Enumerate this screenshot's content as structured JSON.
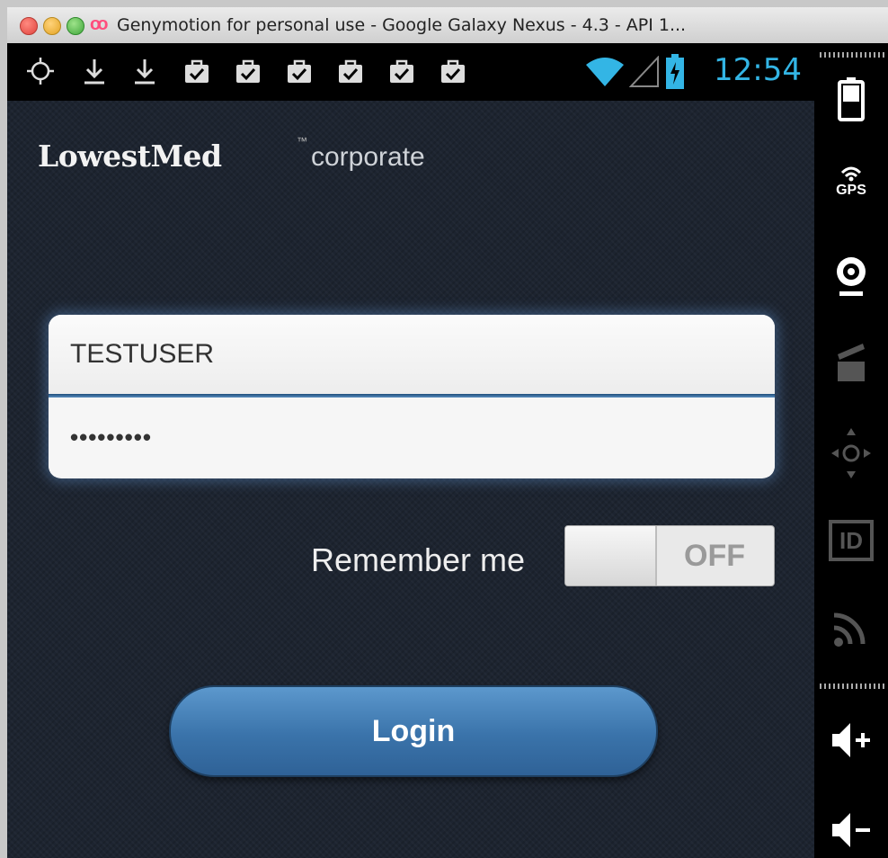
{
  "window": {
    "title": "Genymotion for personal use - Google Galaxy Nexus - 4.3 - API 1...",
    "app_logo": "oo"
  },
  "status_bar": {
    "time": "12:54",
    "icons": [
      "gps-icon",
      "download-icon",
      "download-icon",
      "briefcase-check-icon",
      "briefcase-check-icon",
      "briefcase-check-icon",
      "briefcase-check-icon",
      "briefcase-check-icon",
      "briefcase-check-icon",
      "wifi-icon",
      "signal-icon",
      "battery-charging-icon"
    ],
    "clock_color": "#33b5e5"
  },
  "logo": {
    "brand": "LowestMed",
    "trademark": "™",
    "sub": "corporate"
  },
  "form": {
    "username_value": "TESTUSER",
    "password_value": "•••••••••",
    "remember_label": "Remember me",
    "remember_state": "OFF",
    "login_label": "Login"
  },
  "sidebar": {
    "items": [
      {
        "icon": "battery-icon"
      },
      {
        "icon": "gps-icon",
        "label": "GPS"
      },
      {
        "icon": "webcam-icon"
      },
      {
        "icon": "clapperboard-icon"
      },
      {
        "icon": "dpad-icon"
      },
      {
        "icon": "id-icon",
        "label": "ID"
      },
      {
        "icon": "rss-icon"
      },
      {
        "icon": "volume-up-icon"
      },
      {
        "icon": "volume-down-icon"
      }
    ]
  },
  "colors": {
    "screen_background": "#1d2430",
    "login_button": "#3a73aa",
    "accent_blue": "#33b5e5"
  }
}
